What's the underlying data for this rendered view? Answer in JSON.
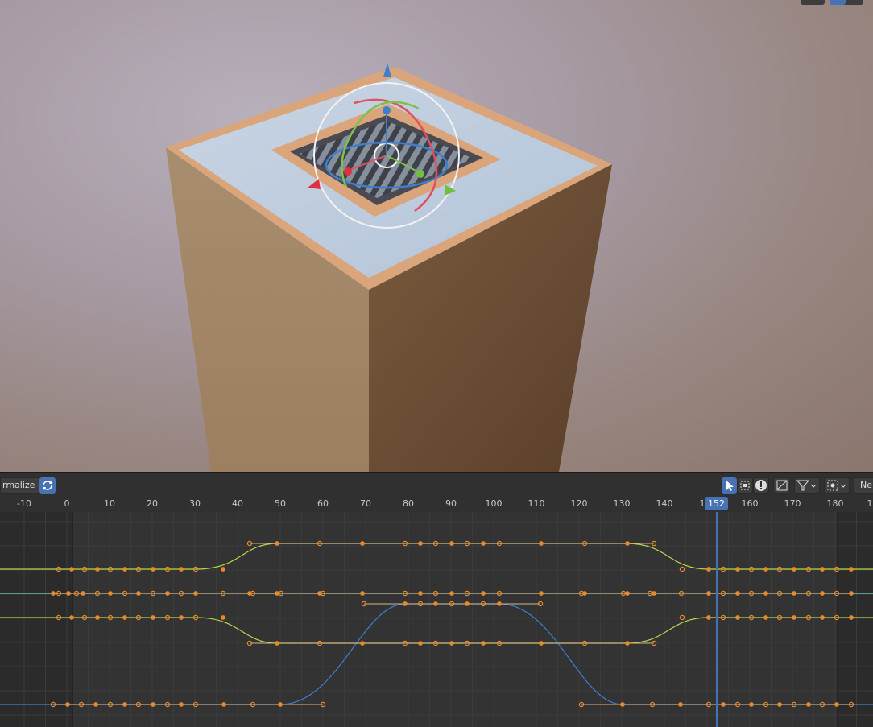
{
  "viewport": {
    "top_right_buttons": [
      "view-dropdown",
      "selection-mode-toggle"
    ]
  },
  "graph_editor": {
    "header": {
      "normalize_label": "rmalize",
      "auto_normalize_icon": "refresh-icon",
      "only_selected_icon": "cursor-arrow-icon",
      "show_hidden_icon": "dashed-box-icon",
      "only_errors_icon": "warning-icon",
      "create_ghost_icon": "ghost-curve-icon",
      "filter_icon": "funnel-icon",
      "pivot_icon": "pivot-point-icon",
      "normalize_mode_label": "Ne"
    },
    "ruler": {
      "ticks": [
        "-10",
        "0",
        "10",
        "20",
        "30",
        "40",
        "50",
        "60",
        "70",
        "80",
        "90",
        "100",
        "110",
        "120",
        "130",
        "140",
        "1",
        "160",
        "170",
        "180",
        "1"
      ],
      "current_frame": "152"
    },
    "colors": {
      "keyframe": "#e8892a",
      "curve_x": "#b4d84a",
      "curve_teal": "#6fd3c7",
      "curve_blue": "#3d7fcf",
      "playhead": "#4772b3",
      "background": "#333333"
    }
  }
}
